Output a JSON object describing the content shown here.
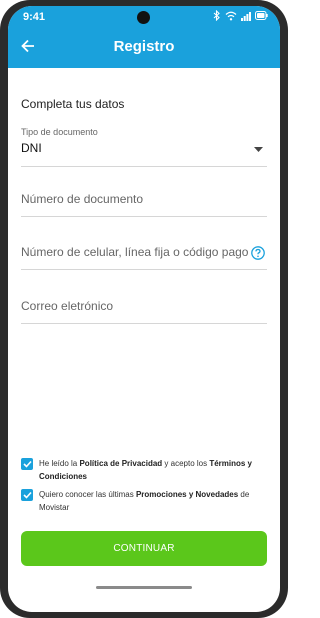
{
  "status_bar": {
    "time": "9:41",
    "icons": [
      "bluetooth-icon",
      "wifi-icon",
      "signal-icon",
      "battery-icon"
    ]
  },
  "app_bar": {
    "title": "Registro",
    "back_icon": "arrow-left-icon"
  },
  "form": {
    "section_title": "Completa tus datos",
    "document_type": {
      "caption": "Tipo de documento",
      "value": "DNI"
    },
    "document_number": {
      "placeholder": "Número de documento"
    },
    "phone": {
      "placeholder": "Número de celular, línea fija o código pago",
      "help_icon": "help-circle-icon"
    },
    "email": {
      "placeholder": "Correo eletrónico"
    }
  },
  "consents": {
    "privacy": {
      "checked": true,
      "text_1": "He leído la ",
      "bold_1": "Política de Privacidad",
      "text_2": " y acepto los ",
      "bold_2": "Términos y Condiciones"
    },
    "promotions": {
      "checked": true,
      "text_1": "Quiero conocer las últimas ",
      "bold_1": "Promociones y Novedades",
      "text_2": " de Movistar"
    }
  },
  "cta": {
    "label": "CONTINUAR"
  },
  "colors": {
    "primary": "#1aa1dc",
    "cta": "#5bc71b",
    "help": "#1aa1dc"
  }
}
